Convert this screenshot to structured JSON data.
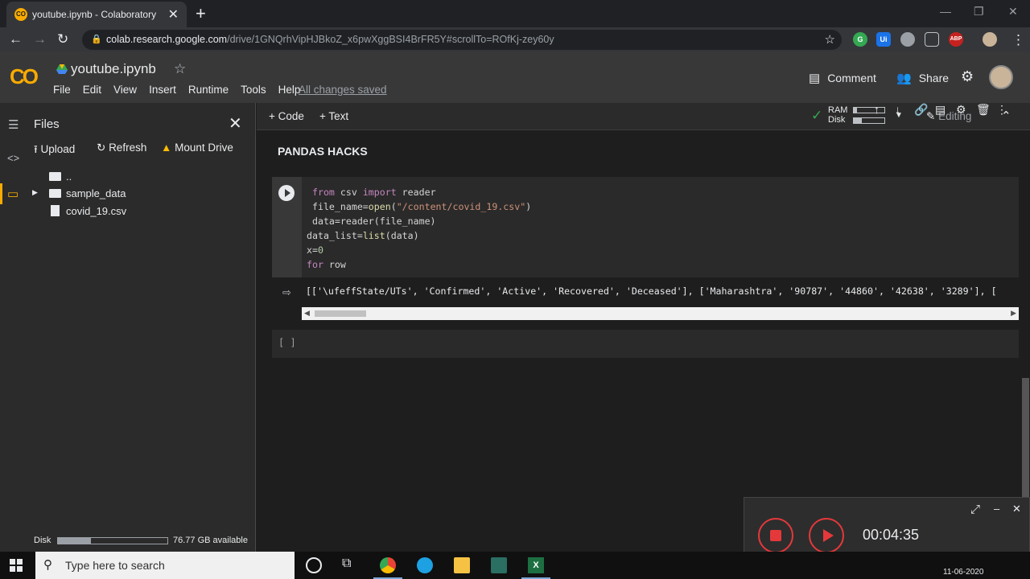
{
  "browser": {
    "tab_title": "youtube.ipynb - Colaboratory",
    "url_host": "colab.research.google.com",
    "url_path": "/drive/1GNQrhVipHJBkoZ_x6pwXggBSI4BrFR5Y#scrollTo=ROfKj-zey60y"
  },
  "colab": {
    "logo": "CO",
    "notebook_title": "youtube.ipynb",
    "menu": [
      "File",
      "Edit",
      "View",
      "Insert",
      "Runtime",
      "Tools",
      "Help"
    ],
    "save_status": "All changes saved",
    "comment_label": "Comment",
    "share_label": "Share"
  },
  "sidebar": {
    "title": "Files",
    "upload_label": "Upload",
    "refresh_label": "Refresh",
    "mount_label": "Mount Drive",
    "tree": {
      "parent": "..",
      "folder": "sample_data",
      "file": "covid_19.csv"
    },
    "disk_label": "Disk",
    "disk_available": "76.77 GB available",
    "disk_fraction": 0.3
  },
  "toolbar": {
    "add_code": "Code",
    "add_text": "Text",
    "ram_label": "RAM",
    "disk_label": "Disk",
    "editing_label": "Editing"
  },
  "notebook": {
    "section_title": "PANDAS HACKS",
    "code_lines": [
      " from csv import reader",
      " file_name=open(\"/content/covid_19.csv\")",
      " data=reader(file_name)",
      "data_list=list(data)",
      "x=0",
      "for row"
    ],
    "output": "[['\\ufeffState/UTs', 'Confirmed', 'Active', 'Recovered', 'Deceased'], ['Maharashtra', '90787', '44860', '42638', '3289'], [",
    "empty_cell": "[ ]"
  },
  "recorder": {
    "time": "00:04:35"
  },
  "taskbar": {
    "search_placeholder": "Type here to search",
    "clock_partial": "11-06-2020"
  },
  "colors": {
    "accent": "#f9ab00",
    "record": "#e5383b",
    "ok": "#34a853"
  }
}
